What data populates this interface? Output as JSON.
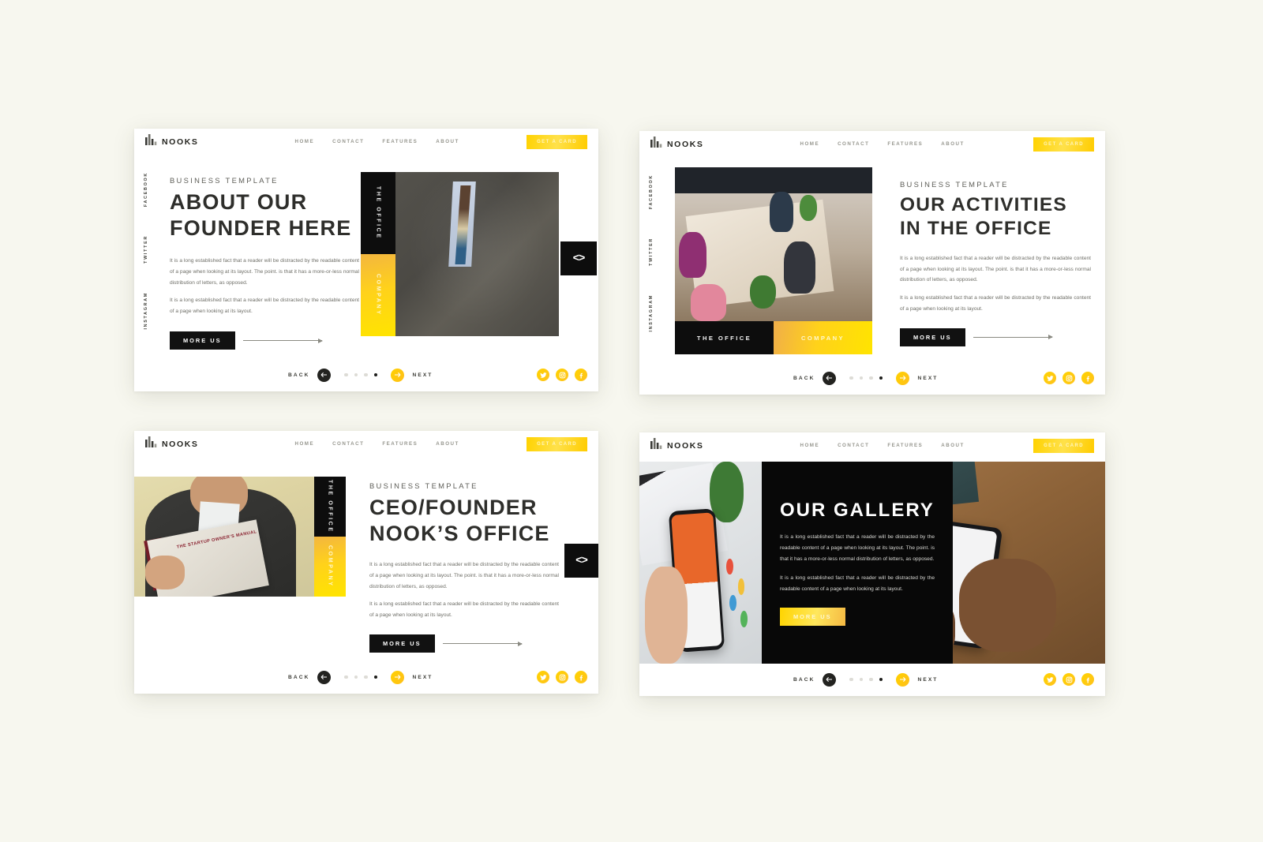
{
  "page": {
    "background_color": "#f7f7ef",
    "accent_yellow": "#ffd200",
    "dark": "#111111"
  },
  "brand": {
    "name": "NOOKS",
    "logo_icon": "bar-chart-icon"
  },
  "nav": {
    "links": [
      "HOME",
      "CONTACT",
      "FEATURES",
      "ABOUT"
    ],
    "cta_label": "GET A CARD"
  },
  "social_rail": [
    "FACEBOOK",
    "TWITTER",
    "INSTAGRAM"
  ],
  "footer": {
    "back_label": "BACK",
    "next_label": "NEXT",
    "back_icon": "arrow-left-icon",
    "next_icon": "arrow-right-icon",
    "dots_total": 4,
    "dot_active_index": 4,
    "social_icons": [
      "twitter-icon",
      "instagram-icon",
      "facebook-icon"
    ]
  },
  "common": {
    "kicker": "BUSINESS TEMPLATE",
    "paragraph_1": "It is a long established fact that a reader will be distracted by the readable content of a page when looking at its layout. The point. is that it has a more-or-less normal distribution of letters, as opposed.",
    "paragraph_2": "It is a long established fact that a reader will be distracted by the readable content of a page when looking at its layout.",
    "more_label": "MORE US",
    "tab_office": "THE OFFICE",
    "tab_company": "COMPANY",
    "code_glyph": "<>"
  },
  "slides": [
    {
      "id": "about-our-founder",
      "headline_line_1": "ABOUT OUR",
      "headline_line_2": "FOUNDER HERE",
      "photo": "man-in-pinstripe-suit"
    },
    {
      "id": "our-activities",
      "headline_line_1": "OUR ACTIVITIES",
      "headline_line_2": "IN THE OFFICE",
      "photo": "team-working-at-office-table"
    },
    {
      "id": "ceo-founder",
      "headline_line_1": "CEO/FOUNDER",
      "headline_line_2": "NOOK’S OFFICE",
      "photo": "man-reading-startup-owners-manual",
      "book_title": "THE STARTUP OWNER’S MANUAL"
    },
    {
      "id": "our-gallery",
      "headline_line_1": "OUR GALLERY",
      "photo_left": "hand-holding-phone-orange-app",
      "photo_right": "hands-holding-phone-at-desk"
    }
  ]
}
